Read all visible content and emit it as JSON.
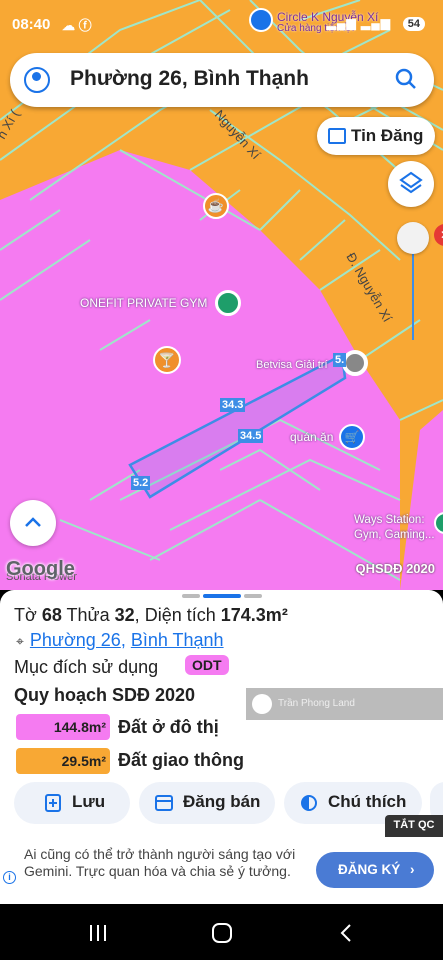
{
  "status": {
    "time": "08:40",
    "icons": "☁ ⓕ",
    "signal": "▂▄▆ ▂▄▆",
    "battery": "54"
  },
  "search": {
    "title": "Phường 26, Bình Thạnh"
  },
  "map": {
    "tin_dang": "Tin Đăng",
    "poi_circle_k": "Circle K Nguyễn Xí",
    "poi_circle_k_sub": "Cửa hàng tiện lợi",
    "poi_gym": "ONEFIT PRIVATE GYM",
    "poi_betvisa": "Betvisa Giải trí",
    "poi_quan_an": "quán ăn",
    "poi_ways": "Ways Station:",
    "poi_ways_sub": "Gym, Gaming...",
    "street_1": "Nguyễn Xí",
    "street_2": "Đ. Nguyễn Xí",
    "poi_flower": "Sonata Flower",
    "google": "Google",
    "layer_name": "QHSDĐ 2020",
    "dims": [
      "34.3",
      "34.5",
      "5.2",
      "5."
    ],
    "colors": {
      "residential": "#f57bf1",
      "traffic": "#f8a834",
      "lines": "#9fe6c9",
      "plot": "#3d8de6"
    }
  },
  "sheet": {
    "parcel_prefix": "Tờ",
    "to": "68",
    "thua_label": "Thửa",
    "thua": "32",
    "area_label": "Diện tích",
    "area": "174.3m²",
    "ward": "Phường 26",
    "district": "Bình Thạnh",
    "purpose_label": "Mục đích sử dụng",
    "purpose_code": "ODT",
    "plan_title": "Quy hoạch SDĐ 2020",
    "zones": [
      {
        "area": "144.8m²",
        "label": "Đất ở đô thị",
        "color": "#f57bf1"
      },
      {
        "area": "29.5m²",
        "label": "Đất giao thông",
        "color": "#f8a834"
      }
    ],
    "watermark": "Trần Phong Land",
    "buttons": {
      "save": "Lưu",
      "post": "Đăng bán",
      "legend": "Chú thích"
    }
  },
  "ad": {
    "close_label": "TẮT QC",
    "text": "Ai cũng có thể trở thành người sáng tạo với Gemini. Trực quan hóa và chia sẻ ý tưởng.",
    "cta": "ĐĂNG KÝ"
  }
}
